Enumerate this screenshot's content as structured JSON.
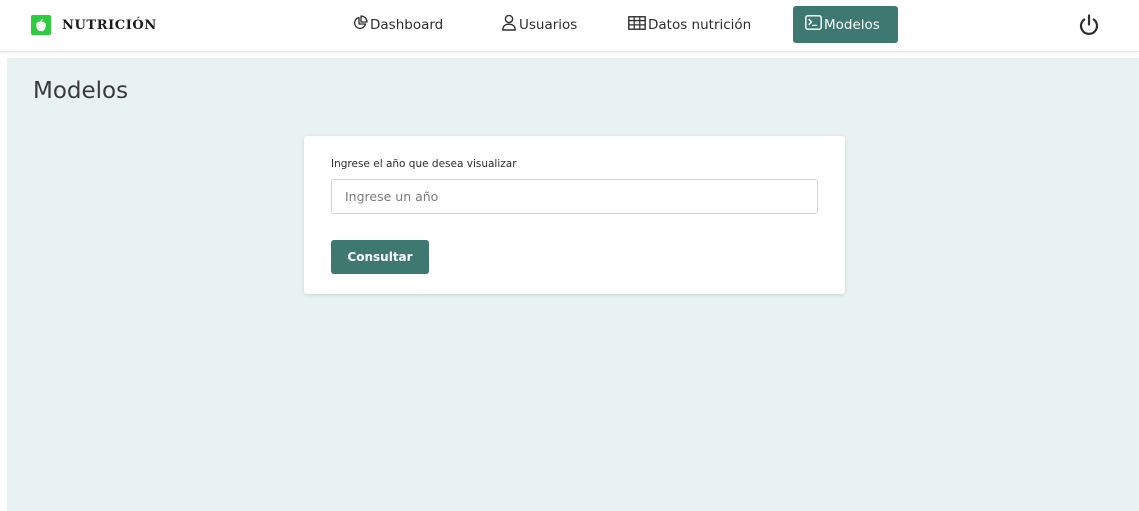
{
  "brand": {
    "name": "NUTRICIÓN",
    "logo_icon": "apple-icon",
    "logo_color": "#2ecc40"
  },
  "nav": {
    "items": [
      {
        "label": "Dashboard",
        "icon": "pie-chart-icon"
      },
      {
        "label": "Usuarios",
        "icon": "user-icon"
      },
      {
        "label": "Datos nutrición",
        "icon": "table-icon"
      },
      {
        "label": "Modelos",
        "icon": "terminal-icon",
        "active": true
      }
    ],
    "logout_icon": "power-icon"
  },
  "page": {
    "title": "Modelos"
  },
  "form": {
    "year_label": "Ingrese el año que desea visualizar",
    "year_placeholder": "Ingrese un año",
    "year_value": "",
    "submit_label": "Consultar"
  },
  "colors": {
    "accent": "#3d7871",
    "background": "#e9f2f2"
  }
}
